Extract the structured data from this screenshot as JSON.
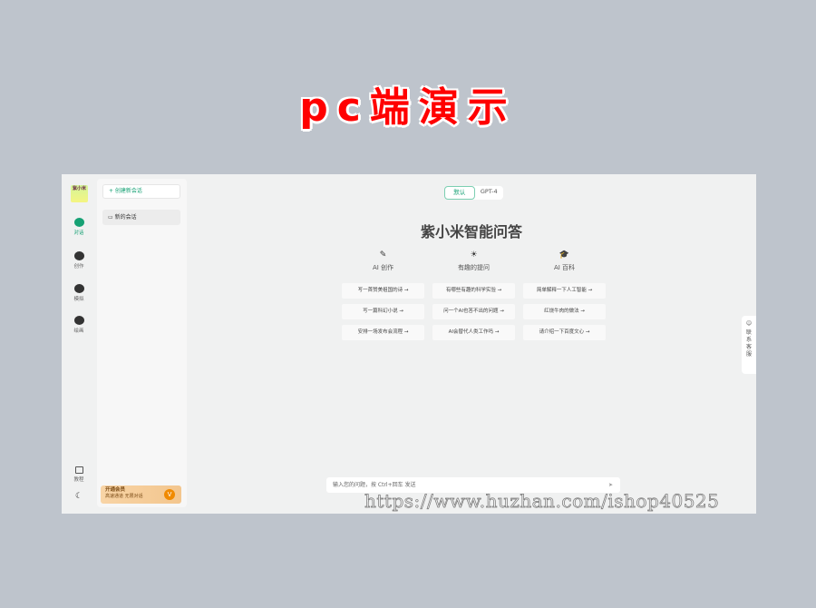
{
  "banner": "pc端演示",
  "rail": {
    "logo": "紫小米",
    "items": [
      {
        "label": "对话",
        "icon": "chat-icon"
      },
      {
        "label": "创作",
        "icon": "feather-icon"
      },
      {
        "label": "模拟",
        "icon": "brain-icon"
      },
      {
        "label": "绘画",
        "icon": "palette-icon"
      }
    ],
    "tutorial": "教程",
    "theme_icon": "moon-icon"
  },
  "sidebar": {
    "new_chat": "+ 创建新会话",
    "chats": [
      "新的会话"
    ],
    "vip": {
      "title": "开通会员",
      "subtitle": "高速通道 无限对话",
      "badge": "V"
    }
  },
  "main": {
    "modes": [
      "默认",
      "GPT-4"
    ],
    "title": "紫小米智能问答",
    "columns": [
      {
        "icon": "feather-icon",
        "glyph": "✎",
        "heading": "AI 创作",
        "prompts": [
          "写一首赞美祖国的诗 →",
          "写一篇科幻小说 →",
          "安排一场发布会流程 →"
        ]
      },
      {
        "icon": "bulb-icon",
        "glyph": "☀",
        "heading": "有趣的提问",
        "prompts": [
          "有哪些有趣的科学实验 →",
          "问一个AI也答不出的问题 →",
          "AI会替代人类工作吗 →"
        ]
      },
      {
        "icon": "graduation-cap-icon",
        "glyph": "🎓",
        "heading": "AI 百科",
        "prompts": [
          "简单解释一下人工智能 →",
          "红烧牛肉的做法 →",
          "请介绍一下百度文心 →"
        ]
      }
    ],
    "input_placeholder": "输入您的问题，按 Ctrl+回车 发送",
    "send_glyph": "➤"
  },
  "contact": {
    "glyph": "☺",
    "label": "联系客服"
  },
  "watermark": "https://www.huzhan.com/ishop40525"
}
